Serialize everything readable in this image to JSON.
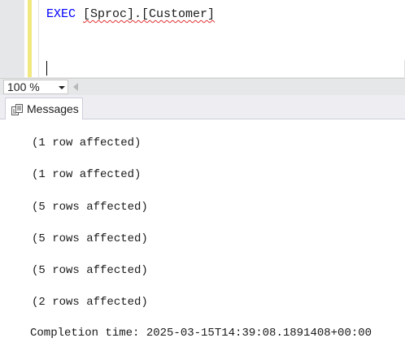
{
  "editor": {
    "keyword": "EXEC",
    "object_name": "[Sproc].[Customer]"
  },
  "zoom": {
    "value": "100 %"
  },
  "tabs": {
    "messages_label": "Messages"
  },
  "messages": {
    "lines": [
      "(1 row affected)",
      "(1 row affected)",
      "(5 rows affected)",
      "(5 rows affected)",
      "(5 rows affected)",
      "(2 rows affected)"
    ],
    "completion": "Completion time: 2025-03-15T14:39:08.1891408+00:00"
  },
  "colors": {
    "keyword": "#0000ff",
    "squiggle": "#e03030",
    "change_bar": "#f2e880"
  },
  "icons": {
    "messages_tab": "messages-icon",
    "zoom_dropdown": "chevron-down-icon",
    "scroll": "scroll-left-icon"
  }
}
